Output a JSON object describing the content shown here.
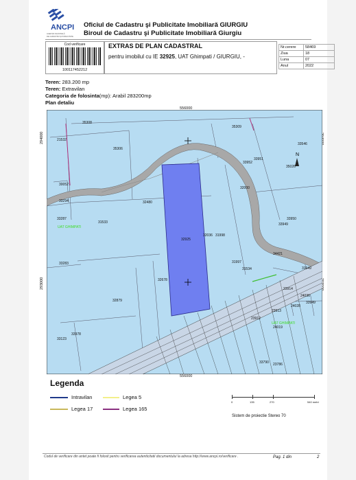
{
  "header": {
    "org_line1": "Oficiul de Cadastru şi Publicitate Imobiliară GIURGIU",
    "org_line2": "Biroul de Cadastru şi Publicitate Imobiliară Giurgiu",
    "logo_text": "ANCPI",
    "logo_subtext": "AGENŢIA NAŢIONALĂ DE CADASTRU ŞI PUBLICITATE IMOBILIARĂ"
  },
  "verification": {
    "label": "Cod verificare",
    "code": "100117452212"
  },
  "extract": {
    "title": "EXTRAS DE PLAN CADASTRAL",
    "subtitle_prefix": "pentru imobilul cu IE ",
    "ie_number": "32925",
    "subtitle_suffix": ", UAT Ghimpati / GIURGIU, -"
  },
  "info_table": [
    {
      "key": "Nr.cerere",
      "value": "58469"
    },
    {
      "key": "Ziua",
      "value": "18"
    },
    {
      "key": "Luna",
      "value": "07"
    },
    {
      "key": "Anul",
      "value": "2022"
    }
  ],
  "teren": {
    "area_label": "Teren:",
    "area_value": "283.200 mp",
    "type_label": "Teren:",
    "type_value": "Extravilan",
    "category_label": "Categoria de folosinta",
    "category_unit": "(mp):",
    "category_value": "Arabil 283200mp",
    "plan_label": "Plan detaliu"
  },
  "map": {
    "coord_top": "556000",
    "coord_bottom": "556000",
    "coord_left_top": "294000",
    "coord_left_bottom": "293000",
    "coord_right_top": "294000",
    "coord_right_bottom": "293000",
    "parcels": [
      "35308",
      "35309",
      "21532",
      "35306",
      "33546",
      "33951",
      "33952",
      "35026",
      "30052",
      "32000",
      "33294",
      "32480",
      "33950",
      "33287",
      "31533",
      "33949",
      "32925",
      "31998",
      "32036",
      "34421",
      "33283",
      "31997",
      "31534",
      "31949",
      "32678",
      "23914",
      "24036",
      "32879",
      "24028",
      "33949",
      "23913",
      "23912",
      "24019",
      "33123",
      "33978",
      "33790",
      "23786"
    ],
    "zone_label": "UAT GHIMPATI"
  },
  "legend": {
    "title": "Legenda",
    "items": [
      {
        "label": "Intravilan",
        "color": "#1f3a8a"
      },
      {
        "label": "Legea 5",
        "color": "#f3f08a"
      },
      {
        "label": "Legea 17",
        "color": "#c9b85a"
      },
      {
        "label": "Legea 165",
        "color": "#8a2f7f"
      }
    ],
    "scale_ticks": [
      "0",
      "135",
      "270",
      "540 metri"
    ],
    "projection": "Sistem de proiectie Stereo 70"
  },
  "footer": {
    "note": "Codul de verificare din antet poate fi folosit pentru verificarea autenticitatii documentului la adresa http://www.ancpi.ro/verificare .",
    "page": "Pag. 1 din",
    "total": "2"
  },
  "colors": {
    "map_bg": "#b7dcf2",
    "target_parcel": "#6f7ff0",
    "road": "#a8a8a8",
    "label_green": "#3fdc25"
  }
}
